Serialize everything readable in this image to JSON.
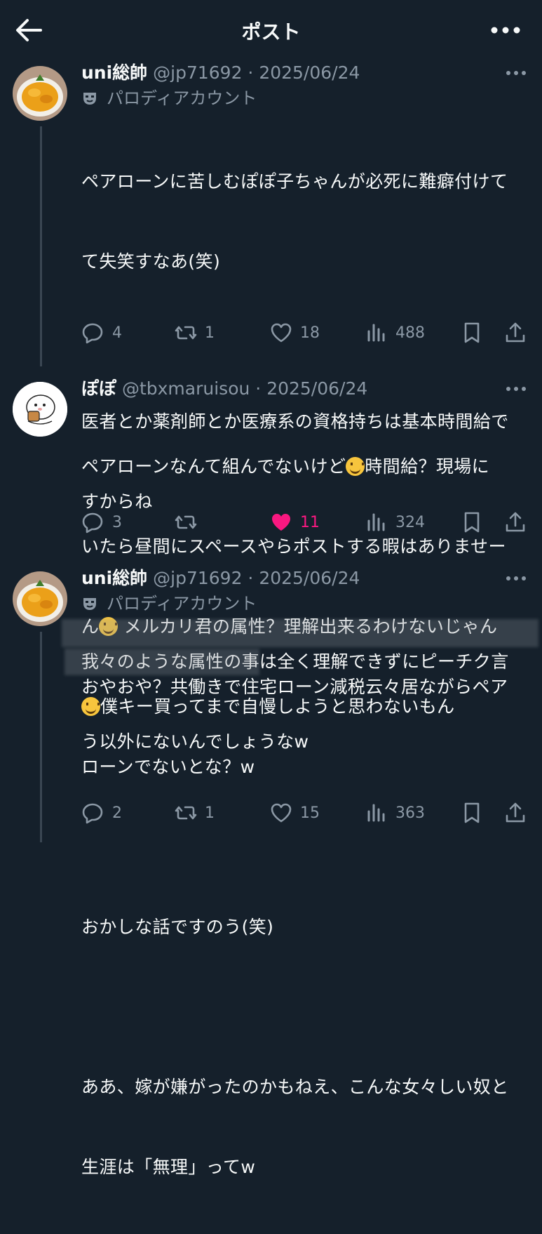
{
  "header": {
    "title": "ポスト"
  },
  "posts": [
    {
      "display_name": "uni総帥",
      "handle": "@jp71692",
      "date": "2025/06/24",
      "parody_label": "パロディアカウント",
      "lines": [
        "ペアローンに苦しむぽぽ子ちゃんが必死に難癖付けて",
        "て失笑すなあ(笑)",
        "",
        "医者とか薬剤師とか医療系の資格持ちは基本時間給で",
        "すからね",
        "",
        "我々のような属性の事は全く理解できずにピーチク言",
        "う以外にないんでしょうなw"
      ],
      "stats": {
        "replies": "4",
        "reposts": "1",
        "likes": "18",
        "views": "488"
      }
    },
    {
      "display_name": "ぽぽ",
      "handle": "@tbxmaruisou",
      "date": "2025/06/24",
      "line_a1": "ペアローンなんて組んでないけど",
      "line_a2": "時間給？現場に",
      "line_b": "いたら昼間にスペースやらポストする暇はありませー",
      "line_c1": "ん",
      "line_c2": "メルカリ君の属性？理解出来るわけないじゃん",
      "line_d": "僕キー買ってまで自慢しようと思わないもん",
      "emoji": [
        "rolling-on-floor-laughing",
        "smiling-face",
        "face-with-tears-of-joy"
      ],
      "stats": {
        "replies": "3",
        "likes": "11",
        "views": "324"
      }
    },
    {
      "display_name": "uni総帥",
      "handle": "@jp71692",
      "date": "2025/06/24",
      "parody_label": "パロディアカウント",
      "lines": [
        "おやおや？共働きで住宅ローン減税云々居ながらペア",
        "ローンでないとな？w",
        "",
        "おかしな話ですのう(笑)",
        "",
        "ああ、嫁が嫌がったのかもねえ、こんな女々しい奴と",
        "生涯は「無理」ってw"
      ],
      "stats": {
        "replies": "2",
        "reposts": "1",
        "likes": "15",
        "views": "363"
      }
    }
  ],
  "colors": {
    "background": "#15202b",
    "text": "#e7e9ea",
    "muted": "#8b98a5",
    "like": "#f91880"
  }
}
